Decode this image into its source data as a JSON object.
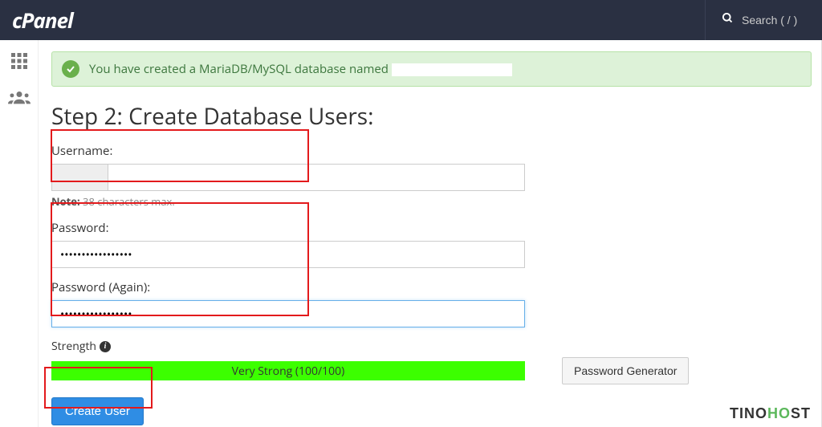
{
  "header": {
    "logo": "cPanel",
    "search_placeholder": "Search ( / )"
  },
  "alert": {
    "message": "You have created a MariaDB/MySQL database named "
  },
  "title": "Step 2: Create Database Users:",
  "username": {
    "label": "Username:",
    "prefix": "",
    "value": "",
    "note_label": "Note:",
    "note_text": " 38 characters max."
  },
  "password": {
    "label": "Password:",
    "value": "•••••••••••••••••"
  },
  "password_again": {
    "label": "Password (Again):",
    "value": "•••••••••••••••••"
  },
  "strength": {
    "label": "Strength",
    "bar_text": "Very Strong (100/100)"
  },
  "buttons": {
    "generator": "Password Generator",
    "create_user": "Create User"
  },
  "watermark": {
    "t1": "TINO",
    "t2": "H",
    "t3": "O",
    "t4": "ST"
  }
}
